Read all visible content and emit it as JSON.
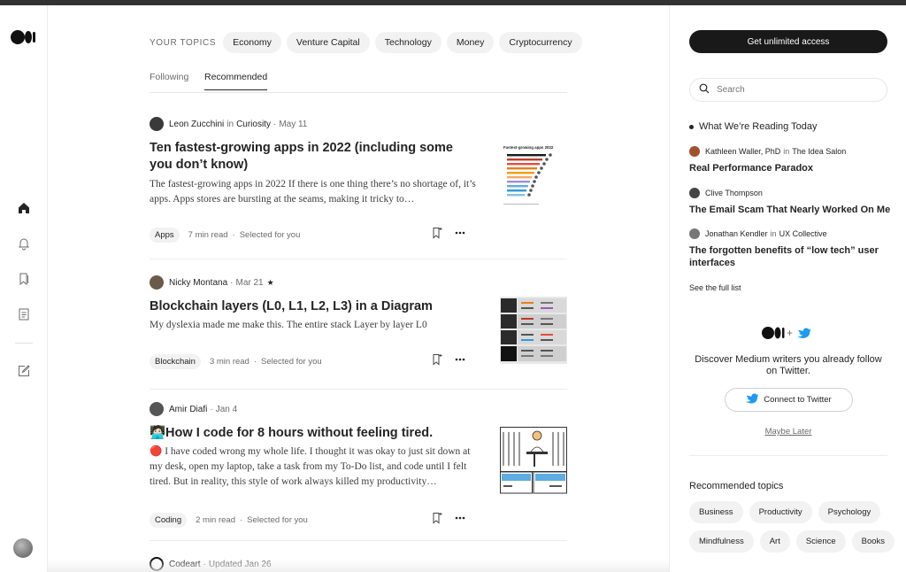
{
  "your_topics": {
    "label": "YOUR TOPICS",
    "items": [
      "Economy",
      "Venture Capital",
      "Technology",
      "Money",
      "Cryptocurrency"
    ]
  },
  "tabs": [
    {
      "label": "Following",
      "active": false
    },
    {
      "label": "Recommended",
      "active": true
    }
  ],
  "articles": [
    {
      "author": "Leon Zucchini",
      "in_word": "in",
      "publication": "Curiosity",
      "sep": "·",
      "date": "May 11",
      "title": "Ten fastest-growing apps in 2022 (including some you don’t know)",
      "snippet": "The fastest-growing apps in 2022 If there is one thing there’s no shortage of, it’s apps. Apps stores are bursting at the seams, making it tricky to…",
      "tag": "Apps",
      "read_time": "7 min read",
      "selected": "Selected for you",
      "dot": "·",
      "thumb_title": "Fastest-growing apps 2022"
    },
    {
      "author": "Nicky Montana",
      "sep": "·",
      "date": "Mar 21",
      "star": "★",
      "title": "Blockchain layers (L0, L1, L2, L3) in a Diagram",
      "snippet": "My dyslexia made me make this. The entire stack Layer by layer L0",
      "tag": "Blockchain",
      "read_time": "3 min read",
      "selected": "Selected for you",
      "dot": "·"
    },
    {
      "author": "Amir Diafi",
      "sep": "·",
      "date": "Jan 4",
      "title": "🧑🏻‍💻How I code for 8 hours without feeling tired.",
      "snippet": "🔴 I have coded wrong my whole life. I thought it was okay to just sit down at my desk, open my laptop, take a task from my To-Do list, and code until I felt tired. But in reality, this style of work always killed my productivity…",
      "tag": "Coding",
      "read_time": "2 min read",
      "selected": "Selected for you",
      "dot": "·"
    },
    {
      "author": "Codeart",
      "sep": "·",
      "date": "Updated Jan 26"
    }
  ],
  "sidebar": {
    "cta": "Get unlimited access",
    "search_placeholder": "Search",
    "reading_heading": "What We’re Reading Today",
    "reading": [
      {
        "author": "Kathleen Waller, PhD",
        "in_word": "in",
        "publication": "The Idea Salon",
        "title": "Real Performance Paradox"
      },
      {
        "author": "Clive Thompson",
        "title": "The Email Scam That Nearly Worked On Me"
      },
      {
        "author": "Jonathan Kendler",
        "in_word": "in",
        "publication": "UX Collective",
        "title": "The forgotten benefits of “low tech” user interfaces"
      }
    ],
    "see_full": "See the full list",
    "plus": "+",
    "twitter_text": "Discover Medium writers you already follow on Twitter.",
    "twitter_button": "Connect to Twitter",
    "maybe_later": "Maybe Later",
    "recommended_heading": "Recommended topics",
    "recommended_topics": [
      "Business",
      "Productivity",
      "Psychology",
      "Mindfulness",
      "Art",
      "Science",
      "Books"
    ]
  },
  "colors": {
    "twitter_blue": "#1d9bf0",
    "text": "#242424",
    "muted": "#6b6b6b",
    "pill_bg": "#f2f2f2",
    "cta_bg": "#191919"
  }
}
